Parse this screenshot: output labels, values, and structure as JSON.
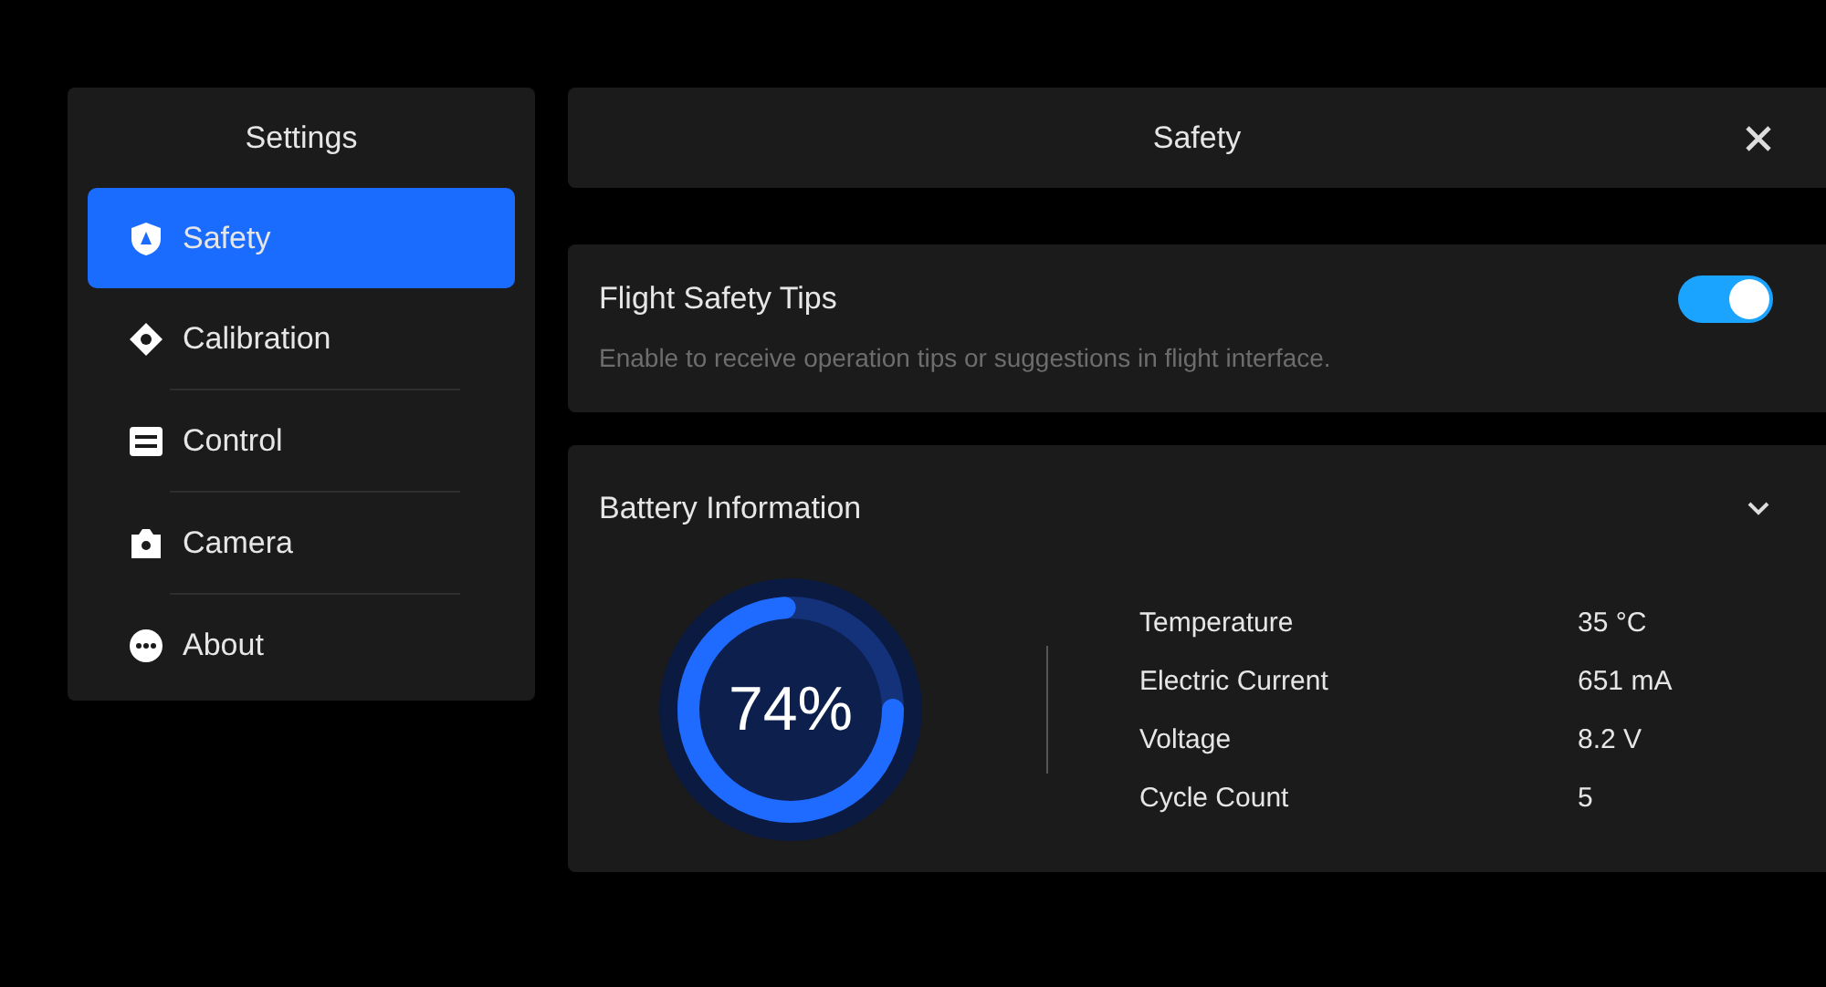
{
  "sidebar": {
    "title": "Settings",
    "items": [
      {
        "label": "Safety",
        "selected": true
      },
      {
        "label": "Calibration",
        "selected": false
      },
      {
        "label": "Control",
        "selected": false
      },
      {
        "label": "Camera",
        "selected": false
      },
      {
        "label": "About",
        "selected": false
      }
    ]
  },
  "header": {
    "title": "Safety"
  },
  "flight_tips": {
    "title": "Flight Safety Tips",
    "description": "Enable to receive operation tips or suggestions in flight interface.",
    "on": true
  },
  "battery": {
    "title": "Battery Information",
    "expanded": true,
    "percent": "74%",
    "level": 0.74,
    "stats": [
      {
        "label": "Temperature",
        "value": "35 °C"
      },
      {
        "label": "Electric Current",
        "value": "651 mA"
      },
      {
        "label": "Voltage",
        "value": "8.2 V"
      },
      {
        "label": "Cycle Count",
        "value": "5"
      }
    ]
  }
}
